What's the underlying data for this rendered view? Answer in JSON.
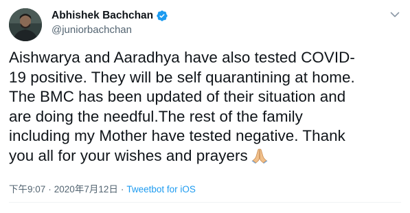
{
  "author": {
    "display_name": "Abhishek Bachchan",
    "handle": "@juniorbachchan",
    "verified": true
  },
  "tweet": {
    "lines": [
      "Aishwarya and Aaradhya have also tested COVID-",
      "19 positive. They will be self quarantining at home.",
      "The BMC has been updated of their situation and",
      "are doing the needful.The rest of the family",
      "including my Mother have tested negative. Thank",
      "you all for your wishes and prayers"
    ],
    "emoji": "folded-hands-emoji"
  },
  "meta": {
    "time": "下午9:07",
    "date": "2020年7月12日",
    "separator": "·",
    "source": "Tweetbot for iOS"
  },
  "icons": {
    "verified": "verified-badge-icon",
    "menu": "chevron-down-icon"
  },
  "colors": {
    "accent": "#1d9bf0",
    "secondary_text": "#536471",
    "primary_text": "#0f1419"
  }
}
